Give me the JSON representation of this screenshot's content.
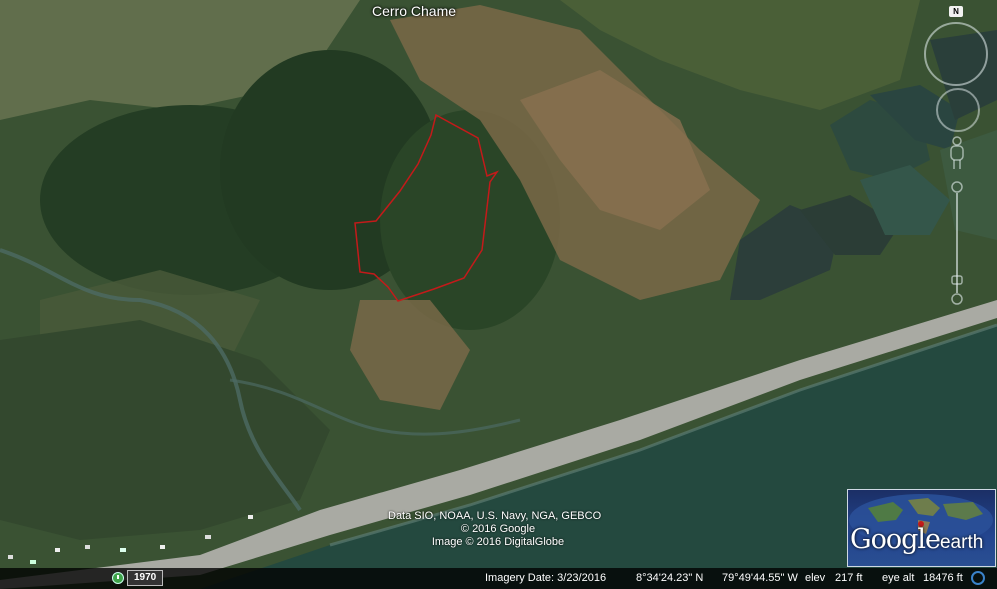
{
  "map": {
    "place_labels": [
      "Cerro Chame"
    ],
    "boundary_color": "#c41a1a",
    "colors": {
      "forest": "#2f4a2d",
      "dry_hills": "#7a6848",
      "ocean": "#24493f",
      "salt_ponds": "#2c3e3a",
      "beach": "#a9aaa3"
    }
  },
  "attribution": {
    "line1": "Data SIO, NOAA, U.S. Navy, NGA, GEBCO",
    "line2": "© 2016 Google",
    "line3": "Image © 2016 DigitalGlobe"
  },
  "status_bar": {
    "historical_year": "1970",
    "imagery_date": "Imagery Date: 3/23/2016",
    "latitude": "8°34'24.23\" N",
    "longitude": "79°49'44.55\" W",
    "elev_label": "elev",
    "elev_value": "217 ft",
    "eye_alt_label": "eye alt",
    "eye_alt_value": "18476 ft"
  },
  "nav": {
    "north_label": "N"
  },
  "logo": {
    "word1": "Google",
    "word2": "earth"
  },
  "icons": [
    "clock-icon",
    "compass-icon",
    "look-joystick-icon",
    "pegman-icon",
    "zoom-slider-icon",
    "streaming-icon",
    "globe-icon"
  ]
}
